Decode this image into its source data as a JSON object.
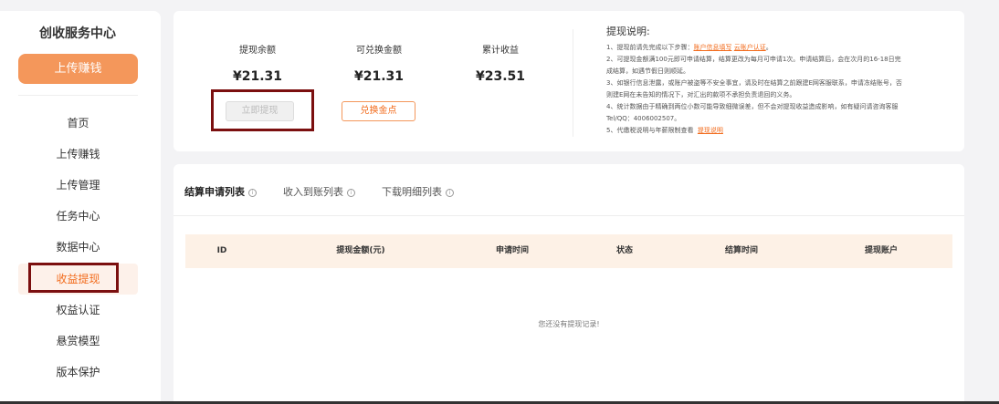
{
  "sidebar": {
    "brand": "创收服务中心",
    "upload_button": "上传赚钱",
    "items": [
      {
        "label": "首页"
      },
      {
        "label": "上传赚钱"
      },
      {
        "label": "上传管理"
      },
      {
        "label": "任务中心"
      },
      {
        "label": "数据中心"
      },
      {
        "label": "收益提现"
      },
      {
        "label": "权益认证"
      },
      {
        "label": "悬赏模型"
      },
      {
        "label": "版本保护"
      }
    ],
    "active_item": "收益提现"
  },
  "balance": {
    "withdrawable_label": "提现余额",
    "withdrawable_value": "¥21.31",
    "exchangeable_label": "可兑换金额",
    "exchangeable_value": "¥21.31",
    "cumulative_label": "累计收益",
    "cumulative_value": "¥23.51",
    "withdraw_button": "立即提现",
    "exchange_button": "兑换金点"
  },
  "notes": {
    "title": "提现说明:",
    "line1_prefix": "1、提现前请先完成以下步骤：",
    "line1_link1": "账户信息填写",
    "line1_link2": "云账户认证",
    "line1_suffix": "。",
    "line2a": "2、可提现金额满100元即可申请结算，结算更改为每月可申请1次。申请结算后，会在次月的16-18日完",
    "line2b": "成结算，如遇节假日则顺延。",
    "line3a": "3、如银行信息泄露，或账户被盗等不安全事宜，请及时在结算之前跟建E网客服联系，申请冻结账号，否",
    "line3b": "则建E网在未告知的情况下，对汇出的款项不承担负责退回的义务。",
    "line4a": "4、统计数据由于精确到两位小数可能导致细微误差，但不会对提现收益造成影响，如有疑问请咨询客服",
    "line4b": "Tel/QQ：4006002507。",
    "line5_prefix": "5、代缴税说明与年薪限制查看",
    "line5_link": "提现说明"
  },
  "tabs": [
    {
      "label": "结算申请列表",
      "active": true
    },
    {
      "label": "收入到账列表",
      "active": false
    },
    {
      "label": "下载明细列表",
      "active": false
    }
  ],
  "table": {
    "columns": [
      "ID",
      "提现金额(元)",
      "申请时间",
      "状态",
      "结算时间",
      "提现账户"
    ],
    "empty_text": "您还没有提现记录!"
  },
  "colors": {
    "accent": "#f4975b",
    "accent_text": "#f26b1c",
    "highlight_box": "#7b0f0f",
    "table_header_bg": "#fdf1e6"
  }
}
